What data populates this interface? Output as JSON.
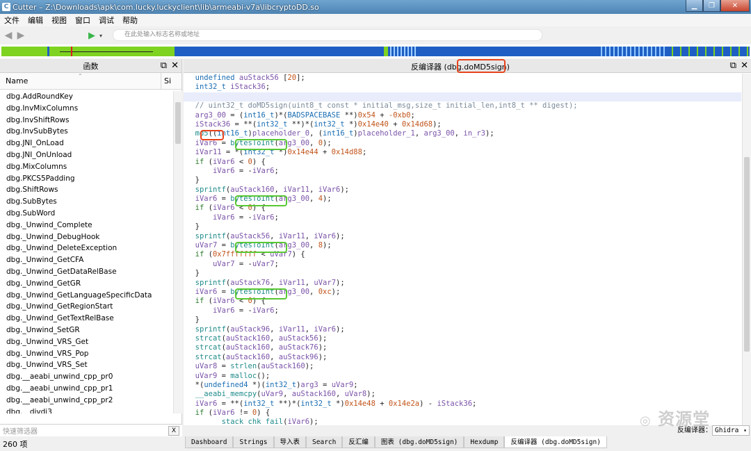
{
  "window": {
    "title": "Cutter – Z:\\Downloads\\apk\\com.lucky.luckyclient\\lib\\armeabi-v7a\\libcryptoDD.so"
  },
  "menu": [
    "文件",
    "编辑",
    "视图",
    "窗口",
    "调试",
    "帮助"
  ],
  "toolbar": {
    "address_placeholder": "在此处输入标志名称或地址"
  },
  "functions_panel": {
    "title": "函数",
    "col_name": "Name",
    "col_size": "Si",
    "items": [
      "dbg.AddRoundKey",
      "dbg.InvMixColumns",
      "dbg.InvShiftRows",
      "dbg.InvSubBytes",
      "dbg.JNI_OnLoad",
      "dbg.JNI_OnUnload",
      "dbg.MixColumns",
      "dbg.PKCS5Padding",
      "dbg.ShiftRows",
      "dbg.SubBytes",
      "dbg.SubWord",
      "dbg._Unwind_Complete",
      "dbg._Unwind_DebugHook",
      "dbg._Unwind_DeleteException",
      "dbg._Unwind_GetCFA",
      "dbg._Unwind_GetDataRelBase",
      "dbg._Unwind_GetGR",
      "dbg._Unwind_GetLanguageSpecificData",
      "dbg._Unwind_GetRegionStart",
      "dbg._Unwind_GetTextRelBase",
      "dbg._Unwind_SetGR",
      "dbg._Unwind_VRS_Get",
      "dbg._Unwind_VRS_Pop",
      "dbg._Unwind_VRS_Set",
      "dbg.__aeabi_unwind_cpp_pr0",
      "dbg.__aeabi_unwind_cpp_pr1",
      "dbg.__aeabi_unwind_cpp_pr2",
      "dbg.__divdi3"
    ],
    "filter_placeholder": "快速筛选器",
    "filter_clear": "X",
    "count": "260 项"
  },
  "decompiler_panel": {
    "title": "反编译器 (dbg.doMD5sign)",
    "lines": [
      [
        [
          "t",
          "undefined"
        ],
        [
          "p",
          " "
        ],
        [
          "v",
          "auStack56"
        ],
        [
          "p",
          " ["
        ],
        [
          "n",
          "20"
        ],
        [
          "p",
          "];"
        ]
      ],
      [
        [
          "t",
          "int32_t"
        ],
        [
          "p",
          " "
        ],
        [
          "v",
          "iStack36"
        ],
        [
          "p",
          ";"
        ]
      ],
      [
        [
          "p",
          ""
        ]
      ],
      [
        [
          "c",
          "// uint32_t doMD5sign(uint8_t const * initial_msg,size_t initial_len,int8_t ** digest);"
        ]
      ],
      [
        [
          "v",
          "arg3_00"
        ],
        [
          "p",
          " = ("
        ],
        [
          "t",
          "int16_t"
        ],
        [
          "p",
          ")*("
        ],
        [
          "t",
          "BADSPACEBASE"
        ],
        [
          "p",
          " **)"
        ],
        [
          "n",
          "0x54"
        ],
        [
          "p",
          " + "
        ],
        [
          "n",
          "-0xb0"
        ],
        [
          "p",
          ";"
        ]
      ],
      [
        [
          "v",
          "iStack36"
        ],
        [
          "p",
          " = **("
        ],
        [
          "t",
          "int32_t"
        ],
        [
          "p",
          " **)*("
        ],
        [
          "t",
          "int32_t"
        ],
        [
          "p",
          " *)"
        ],
        [
          "n",
          "0x14e40"
        ],
        [
          "p",
          " + "
        ],
        [
          "n",
          "0x14d68"
        ],
        [
          "p",
          ");"
        ]
      ],
      [
        [
          "f",
          "md5"
        ],
        [
          "p",
          "(("
        ],
        [
          "t",
          "int16_t"
        ],
        [
          "p",
          ")"
        ],
        [
          "v",
          "placeholder_0"
        ],
        [
          "p",
          ", ("
        ],
        [
          "t",
          "int16_t"
        ],
        [
          "p",
          ")"
        ],
        [
          "v",
          "placeholder_1"
        ],
        [
          "p",
          ", "
        ],
        [
          "v",
          "arg3_00"
        ],
        [
          "p",
          ", "
        ],
        [
          "v",
          "in_r3"
        ],
        [
          "p",
          ");"
        ]
      ],
      [
        [
          "v",
          "iVar6"
        ],
        [
          "p",
          " = "
        ],
        [
          "f",
          "bytesToInt"
        ],
        [
          "p",
          "("
        ],
        [
          "v",
          "arg3_00"
        ],
        [
          "p",
          ", "
        ],
        [
          "n",
          "0"
        ],
        [
          "p",
          ");"
        ]
      ],
      [
        [
          "v",
          "iVar11"
        ],
        [
          "p",
          " = *("
        ],
        [
          "t",
          "int32_t"
        ],
        [
          "p",
          " *)"
        ],
        [
          "n",
          "0x14e44"
        ],
        [
          "p",
          " + "
        ],
        [
          "n",
          "0x14d88"
        ],
        [
          "p",
          ";"
        ]
      ],
      [
        [
          "k",
          "if"
        ],
        [
          "p",
          " ("
        ],
        [
          "v",
          "iVar6"
        ],
        [
          "p",
          " < "
        ],
        [
          "n",
          "0"
        ],
        [
          "p",
          ") {"
        ]
      ],
      [
        [
          "p",
          "    "
        ],
        [
          "v",
          "iVar6"
        ],
        [
          "p",
          " = -"
        ],
        [
          "v",
          "iVar6"
        ],
        [
          "p",
          ";"
        ]
      ],
      [
        [
          "p",
          "}"
        ]
      ],
      [
        [
          "f",
          "sprintf"
        ],
        [
          "p",
          "("
        ],
        [
          "v",
          "auStack160"
        ],
        [
          "p",
          ", "
        ],
        [
          "v",
          "iVar11"
        ],
        [
          "p",
          ", "
        ],
        [
          "v",
          "iVar6"
        ],
        [
          "p",
          ");"
        ]
      ],
      [
        [
          "v",
          "iVar6"
        ],
        [
          "p",
          " = "
        ],
        [
          "f",
          "bytesToInt"
        ],
        [
          "p",
          "("
        ],
        [
          "v",
          "arg3_00"
        ],
        [
          "p",
          ", "
        ],
        [
          "n",
          "4"
        ],
        [
          "p",
          ");"
        ]
      ],
      [
        [
          "k",
          "if"
        ],
        [
          "p",
          " ("
        ],
        [
          "v",
          "iVar6"
        ],
        [
          "p",
          " < "
        ],
        [
          "n",
          "0"
        ],
        [
          "p",
          ") {"
        ]
      ],
      [
        [
          "p",
          "    "
        ],
        [
          "v",
          "iVar6"
        ],
        [
          "p",
          " = -"
        ],
        [
          "v",
          "iVar6"
        ],
        [
          "p",
          ";"
        ]
      ],
      [
        [
          "p",
          "}"
        ]
      ],
      [
        [
          "f",
          "sprintf"
        ],
        [
          "p",
          "("
        ],
        [
          "v",
          "auStack56"
        ],
        [
          "p",
          ", "
        ],
        [
          "v",
          "iVar11"
        ],
        [
          "p",
          ", "
        ],
        [
          "v",
          "iVar6"
        ],
        [
          "p",
          ");"
        ]
      ],
      [
        [
          "v",
          "uVar7"
        ],
        [
          "p",
          " = "
        ],
        [
          "f",
          "bytesToInt"
        ],
        [
          "p",
          "("
        ],
        [
          "v",
          "arg3_00"
        ],
        [
          "p",
          ", "
        ],
        [
          "n",
          "8"
        ],
        [
          "p",
          ");"
        ]
      ],
      [
        [
          "k",
          "if"
        ],
        [
          "p",
          " ("
        ],
        [
          "n",
          "0x7fffffff"
        ],
        [
          "p",
          " < "
        ],
        [
          "v",
          "uVar7"
        ],
        [
          "p",
          ") {"
        ]
      ],
      [
        [
          "p",
          "    "
        ],
        [
          "v",
          "uVar7"
        ],
        [
          "p",
          " = -"
        ],
        [
          "v",
          "uVar7"
        ],
        [
          "p",
          ";"
        ]
      ],
      [
        [
          "p",
          "}"
        ]
      ],
      [
        [
          "f",
          "sprintf"
        ],
        [
          "p",
          "("
        ],
        [
          "v",
          "auStack76"
        ],
        [
          "p",
          ", "
        ],
        [
          "v",
          "iVar11"
        ],
        [
          "p",
          ", "
        ],
        [
          "v",
          "uVar7"
        ],
        [
          "p",
          ");"
        ]
      ],
      [
        [
          "v",
          "iVar6"
        ],
        [
          "p",
          " = "
        ],
        [
          "f",
          "bytesToInt"
        ],
        [
          "p",
          "("
        ],
        [
          "v",
          "arg3_00"
        ],
        [
          "p",
          ", "
        ],
        [
          "n",
          "0xc"
        ],
        [
          "p",
          ");"
        ]
      ],
      [
        [
          "k",
          "if"
        ],
        [
          "p",
          " ("
        ],
        [
          "v",
          "iVar6"
        ],
        [
          "p",
          " < "
        ],
        [
          "n",
          "0"
        ],
        [
          "p",
          ") {"
        ]
      ],
      [
        [
          "p",
          "    "
        ],
        [
          "v",
          "iVar6"
        ],
        [
          "p",
          " = -"
        ],
        [
          "v",
          "iVar6"
        ],
        [
          "p",
          ";"
        ]
      ],
      [
        [
          "p",
          "}"
        ]
      ],
      [
        [
          "f",
          "sprintf"
        ],
        [
          "p",
          "("
        ],
        [
          "v",
          "auStack96"
        ],
        [
          "p",
          ", "
        ],
        [
          "v",
          "iVar11"
        ],
        [
          "p",
          ", "
        ],
        [
          "v",
          "iVar6"
        ],
        [
          "p",
          ");"
        ]
      ],
      [
        [
          "f",
          "strcat"
        ],
        [
          "p",
          "("
        ],
        [
          "v",
          "auStack160"
        ],
        [
          "p",
          ", "
        ],
        [
          "v",
          "auStack56"
        ],
        [
          "p",
          ");"
        ]
      ],
      [
        [
          "f",
          "strcat"
        ],
        [
          "p",
          "("
        ],
        [
          "v",
          "auStack160"
        ],
        [
          "p",
          ", "
        ],
        [
          "v",
          "auStack76"
        ],
        [
          "p",
          ");"
        ]
      ],
      [
        [
          "f",
          "strcat"
        ],
        [
          "p",
          "("
        ],
        [
          "v",
          "auStack160"
        ],
        [
          "p",
          ", "
        ],
        [
          "v",
          "auStack96"
        ],
        [
          "p",
          ");"
        ]
      ],
      [
        [
          "v",
          "uVar8"
        ],
        [
          "p",
          " = "
        ],
        [
          "f",
          "strlen"
        ],
        [
          "p",
          "("
        ],
        [
          "v",
          "auStack160"
        ],
        [
          "p",
          ");"
        ]
      ],
      [
        [
          "v",
          "uVar9"
        ],
        [
          "p",
          " = "
        ],
        [
          "f",
          "malloc"
        ],
        [
          "p",
          "();"
        ]
      ],
      [
        [
          "p",
          "*("
        ],
        [
          "t",
          "undefined4"
        ],
        [
          "p",
          " *)("
        ],
        [
          "t",
          "int32_t"
        ],
        [
          "p",
          ")"
        ],
        [
          "v",
          "arg3"
        ],
        [
          "p",
          " = "
        ],
        [
          "v",
          "uVar9"
        ],
        [
          "p",
          ";"
        ]
      ],
      [
        [
          "f",
          "__aeabi_memcpy"
        ],
        [
          "p",
          "("
        ],
        [
          "v",
          "uVar9"
        ],
        [
          "p",
          ", "
        ],
        [
          "v",
          "auStack160"
        ],
        [
          "p",
          ", "
        ],
        [
          "v",
          "uVar8"
        ],
        [
          "p",
          ");"
        ]
      ],
      [
        [
          "v",
          "iVar6"
        ],
        [
          "p",
          " = **("
        ],
        [
          "t",
          "int32_t"
        ],
        [
          "p",
          " **)*("
        ],
        [
          "t",
          "int32_t"
        ],
        [
          "p",
          " *)"
        ],
        [
          "n",
          "0x14e48"
        ],
        [
          "p",
          " + "
        ],
        [
          "n",
          "0x14e2a"
        ],
        [
          "p",
          ") - "
        ],
        [
          "v",
          "iStack36"
        ],
        [
          "p",
          ";"
        ]
      ],
      [
        [
          "k",
          "if"
        ],
        [
          "p",
          " ("
        ],
        [
          "v",
          "iVar6"
        ],
        [
          "p",
          " != "
        ],
        [
          "n",
          "0"
        ],
        [
          "p",
          ") {"
        ]
      ],
      [
        [
          "p",
          "    "
        ],
        [
          "f",
          "__stack_chk_fail"
        ],
        [
          "p",
          "("
        ],
        [
          "v",
          "iVar6"
        ],
        [
          "p",
          ");"
        ]
      ]
    ]
  },
  "bottom_tabs": [
    "Dashboard",
    "Strings",
    "导入表",
    "Search",
    "反汇编",
    "图表 (dbg.doMD5sign)",
    "Hexdump",
    "反编译器 (dbg.doMD5sign)"
  ],
  "decompiler_selector": {
    "label": "反编译器：",
    "value": "Ghidra"
  },
  "watermark": "资源堂",
  "colors": {
    "highlight_red": "#e8431a",
    "highlight_green": "#58c832",
    "overview_green": "#7ed321",
    "overview_blue": "#1f5fc4"
  }
}
